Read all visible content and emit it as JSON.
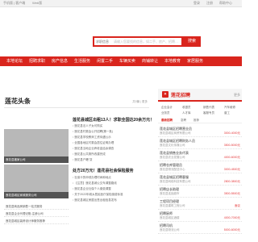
{
  "topbar": {
    "left": "手机版 | 客户端",
    "links": [
      "Web版",
      "登录",
      "注册",
      "帮助中心"
    ]
  },
  "search": {
    "category": "求职信息",
    "placeholder": "请输入您要找的信息，如二手、房产、招聘…",
    "button": "搜索"
  },
  "nav": {
    "items": [
      "本地论坛",
      "招聘求职",
      "房产信息",
      "生活服务",
      "闲置二手",
      "车辆买卖",
      "商铺转让",
      "本地教育",
      "家居服务"
    ]
  },
  "headlines": {
    "title": "莲花头条",
    "meta": "共9篇 | 更多",
    "banner_captions": [
      "莲花县搬家公司",
      "莲花县城区家政服务公司"
    ],
    "thumb_list": [
      "莲花县商品房销售一站式服务",
      "莲花县企业代理记账-注册公司",
      "莲花县城区装修设计师服务推荐"
    ],
    "lead_1": "莲花县城区出租13人！求职全国达20余万元！",
    "rows_1": [
      "莲花县法人子女可购买",
      "莲花县村委会公开招聘(第一批)",
      "莲花县学校教师工资待遇公示",
      "全国各地区村委会居住证明办理",
      "莲花县当地企业养老金结余调查",
      "莲花县公共厕所改建完成",
      "莲花县户籍\"变"
    ],
    "lead_2": "处方20万元！莲花县社会保险服务",
    "rows_2": [
      "社保卡的申领办理时间和地点",
      "【注意】莲花县城公交车调整路线",
      "莲花县企业社保个人缴费调整",
      "关于2022年城乡居民医疗保险缴费标准",
      "莲花县城区房屋出售出租信息发布"
    ]
  },
  "recruit": {
    "title": "莲花招聘",
    "sub": "更多",
    "grid": [
      "企业会计",
      "收银员",
      "销售代表",
      "汽车维修",
      "业务员",
      "人才库",
      "客服专员",
      "普工"
    ],
    "tabs": [
      "最新招聘",
      "急聘",
      "推荐"
    ],
    "jobs": [
      {
        "title": "莲花县城区招聘营业员",
        "company": "莲花县城区商贸有限公司",
        "salary": "3000-4000元"
      },
      {
        "title": "莲花县城区招聘财务人员",
        "company": "莲花县文化传媒公司",
        "salary": "3500-5000元"
      },
      {
        "title": "莲花县销售业务代表",
        "company": "莲花县农业发展公司",
        "salary": "4000-6000元"
      },
      {
        "title": "招聘仓库管理员",
        "company": "莲花县物流配送中心",
        "salary": "3000-4500元"
      },
      {
        "title": "莲花县城区招聘客服",
        "company": "莲花县网络科技有限公司",
        "salary": "2800-3800元"
      },
      {
        "title": "招聘店长助理",
        "company": "莲花县连锁超市",
        "salary": "3500-5500元"
      },
      {
        "title": "工程项目经理",
        "company": "莲花县建筑工程公司",
        "salary": "面议"
      },
      {
        "title": "招聘厨师",
        "company": "莲花县城区酒楼",
        "salary": "4000-7000元"
      },
      {
        "title": "招聘司机",
        "company": "莲花县物流公司",
        "salary": "5000-6000元"
      }
    ]
  },
  "colors": {
    "brand": "#d9251d"
  }
}
